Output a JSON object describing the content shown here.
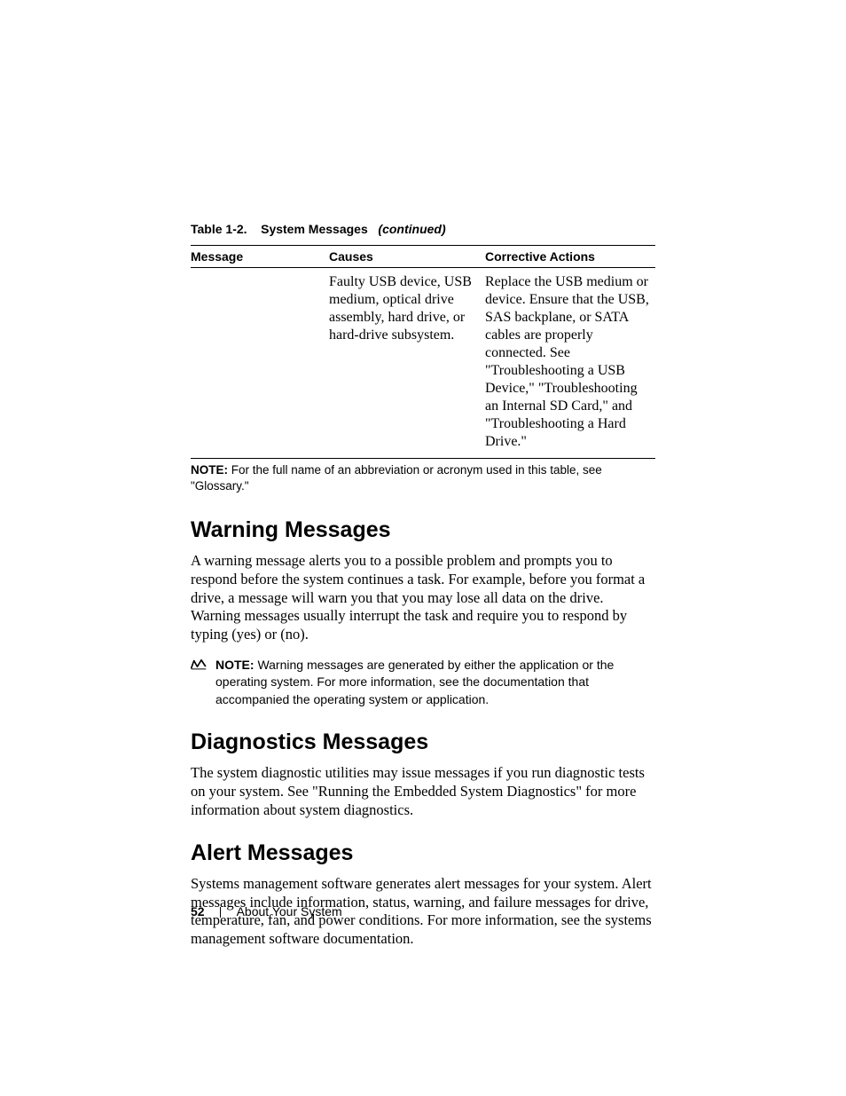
{
  "table": {
    "caption_label": "Table 1-2.",
    "caption_title": "System Messages",
    "caption_suffix": "(continued)",
    "headers": {
      "message": "Message",
      "causes": "Causes",
      "actions": "Corrective Actions"
    },
    "row": {
      "message": "",
      "causes": "Faulty USB device, USB medium, optical drive assembly, hard drive, or hard-drive subsystem.",
      "actions": "Replace the USB medium or device. Ensure that the USB, SAS backplane, or SATA cables are properly connected. See \"Troubleshooting a USB Device,\" \"Troubleshooting an Internal SD Card,\" and \"Troubleshooting a Hard Drive.\""
    },
    "note_prefix": "NOTE:",
    "note_text": " For the full name of an abbreviation or acronym used in this table, see \"Glossary.\""
  },
  "sections": {
    "warning": {
      "heading": "Warning Messages",
      "body": "A warning message alerts you to a possible problem and prompts you to respond before the system continues a task. For example, before you format a drive, a message will warn you that you may lose all data on the drive. Warning messages usually interrupt the task and require you to respond by typing    (yes) or    (no).",
      "note_prefix": "NOTE:",
      "note_text": " Warning messages are generated by either the application or the operating system. For more information, see the documentation that accompanied the operating system or application."
    },
    "diagnostics": {
      "heading": "Diagnostics Messages",
      "body": "The system diagnostic utilities may issue messages if you run diagnostic tests on your system. See \"Running the Embedded System Diagnostics\" for more information about system diagnostics."
    },
    "alert": {
      "heading": "Alert Messages",
      "body": "Systems management software generates alert messages for your system. Alert messages include information, status, warning, and failure messages for drive, temperature, fan, and power conditions. For more information, see the systems management software documentation."
    }
  },
  "footer": {
    "page_number": "52",
    "section_name": "About Your System"
  }
}
